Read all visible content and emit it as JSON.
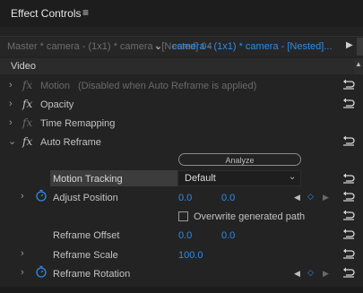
{
  "panel": {
    "title": "Effect Controls",
    "menu_glyph": "≡"
  },
  "sequence_bar": {
    "master_tab": "Master * camera - (1x1) * camera - [Nested] 04",
    "sequence_tab": "camera - (1x1) * camera - [Nested]...",
    "chevron_glyph": "⌄",
    "overflow_glyph": "▶"
  },
  "section": {
    "label": "Video"
  },
  "effects": [
    {
      "label": "Motion",
      "note": "(Disabled when Auto Reframe is applied)"
    },
    {
      "label": "Opacity"
    },
    {
      "label": "Time Remapping"
    },
    {
      "label": "Auto Reframe"
    }
  ],
  "auto_reframe": {
    "analyze_label": "Analyze",
    "motion_tracking_label": "Motion Tracking",
    "motion_tracking_value": "Default",
    "adjust_position_label": "Adjust Position",
    "adjust_position_x": "0.0",
    "adjust_position_y": "0.0",
    "overwrite_label": "Overwrite generated path",
    "reframe_offset_label": "Reframe Offset",
    "reframe_offset_x": "0.0",
    "reframe_offset_y": "0.0",
    "reframe_scale_label": "Reframe Scale",
    "reframe_scale_value": "100.0",
    "reframe_rotation_label": "Reframe Rotation"
  },
  "glyphs": {
    "fx": "fx",
    "chevron_right": "›",
    "chevron_down": "⌄",
    "kf_prev": "◀",
    "kf_next": "▶",
    "kf_add": "◇",
    "caret": "⌄"
  },
  "colors": {
    "accent": "#2d8ceb",
    "background": "#232323"
  }
}
